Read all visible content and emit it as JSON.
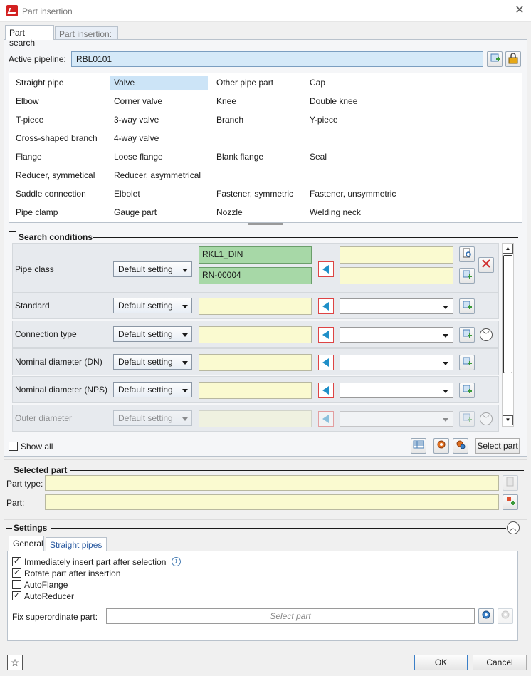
{
  "window": {
    "title": "Part insertion"
  },
  "tabs": [
    {
      "label": "Part search"
    },
    {
      "label": "Part insertion:"
    }
  ],
  "pipeline": {
    "label": "Active pipeline:",
    "value": "RBL0101"
  },
  "part_types": [
    [
      "Straight pipe",
      "Valve",
      "Other pipe part",
      "Cap"
    ],
    [
      "Elbow",
      "Corner valve",
      "Knee",
      "Double knee"
    ],
    [
      "T-piece",
      "3-way valve",
      "Branch",
      "Y-piece"
    ],
    [
      "Cross-shaped branch",
      "4-way valve",
      "",
      ""
    ],
    [
      "Flange",
      "Loose flange",
      "Blank flange",
      "Seal"
    ],
    [
      "Reducer, symmetical",
      "Reducer, asymmetrical",
      "",
      ""
    ],
    [
      "Saddle connection",
      "Elbolet",
      "Fastener, symmetric",
      "Fastener, unsymmetric"
    ],
    [
      "Pipe clamp",
      "Gauge part",
      "Nozzle",
      "Welding neck"
    ]
  ],
  "selected_part_type": "Valve",
  "search": {
    "title": "Search conditions",
    "rows": [
      {
        "label": "Pipe class",
        "mode": "Default setting",
        "values": [
          "RKL1_DIN",
          "RN-00004"
        ]
      },
      {
        "label": "Standard",
        "mode": "Default setting"
      },
      {
        "label": "Connection type",
        "mode": "Default setting"
      },
      {
        "label": "Nominal diameter (DN)",
        "mode": "Default setting"
      },
      {
        "label": "Nominal diameter (NPS)",
        "mode": "Default setting"
      },
      {
        "label": "Outer diameter",
        "mode": "Default setting"
      }
    ],
    "show_all": "Show all",
    "select_part": "Select part"
  },
  "selected_part": {
    "title": "Selected part",
    "type_label": "Part type:",
    "type_value": "",
    "part_label": "Part:",
    "part_value": ""
  },
  "settings": {
    "title": "Settings",
    "tabs": [
      {
        "label": "General"
      },
      {
        "label": "Straight pipes"
      }
    ],
    "options": [
      {
        "label": "Immediately insert part after selection",
        "checked": true
      },
      {
        "label": "Rotate part after insertion",
        "checked": true
      },
      {
        "label": "AutoFlange",
        "checked": false
      },
      {
        "label": "AutoReducer",
        "checked": true
      }
    ],
    "fix_label": "Fix superordinate part:",
    "fix_placeholder": "Select part"
  },
  "footer": {
    "ok": "OK",
    "cancel": "Cancel"
  },
  "icons": {
    "app": "app-logo-icon",
    "close": "close-icon",
    "lock": "lock-icon",
    "info": "info-icon",
    "star": "star-icon"
  }
}
